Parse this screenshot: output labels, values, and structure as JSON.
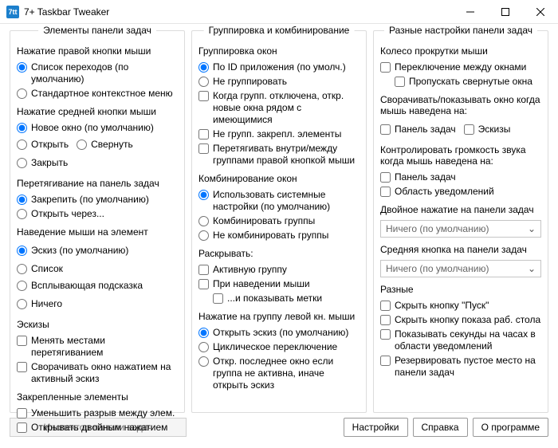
{
  "window": {
    "title": "7+ Taskbar Tweaker"
  },
  "col1": {
    "legend": "Элементы панели задач",
    "rightClick": {
      "title": "Нажатие правой кнопки мыши",
      "jumpList": "Список переходов (по умолчанию)",
      "stdMenu": "Стандартное контекстное меню"
    },
    "middleClick": {
      "title": "Нажатие средней кнопки мыши",
      "newWin": "Новое окно (по умолчанию)",
      "open": "Открыть",
      "minimize": "Свернуть",
      "close": "Закрыть"
    },
    "drag": {
      "title": "Перетягивание на панель задач",
      "pin": "Закрепить (по умолчанию)",
      "openWith": "Открыть через..."
    },
    "hover": {
      "title": "Наведение мыши на элемент",
      "thumb": "Эскиз (по умолчанию)",
      "list": "Список",
      "tooltip": "Всплывающая подсказка",
      "nothing": "Ничего"
    },
    "thumbs": {
      "title": "Эскизы",
      "dragReorder": "Менять местами перетягиванием",
      "minimizeActive": "Сворачивать окно нажатием на активный эскиз"
    },
    "pinned": {
      "title": "Закрепленные элементы",
      "reduceGap": "Уменьшить разрыв между элем.",
      "dblClickOpen": "Открывать двойным нажатием"
    }
  },
  "col2": {
    "legend": "Группировка и комбинирование",
    "grouping": {
      "title": "Группировка окон",
      "byAppId": "По ID приложения (по умолч.)",
      "dontGroup": "Не группировать",
      "whenOff": "Когда групп. отключена, откр. новые окна рядом с имеющимися",
      "dontGroupPinned": "Не групп. закрепл. элементы",
      "dragBetween": "Перетягивать внутри/между группами правой кнопкой мыши"
    },
    "combining": {
      "title": "Комбинирование окон",
      "system": "Использовать системные настройки (по умолчанию)",
      "combine": "Комбинировать группы",
      "dontCombine": "Не комбинировать группы"
    },
    "decombine": {
      "title": "Раскрывать:",
      "active": "Активную группу",
      "onHover": "При наведении мыши",
      "showLabels": "...и показывать метки"
    },
    "leftClick": {
      "title": "Нажатие на группу левой кн. мыши",
      "openThumb": "Открыть эскиз (по умолчанию)",
      "cycle": "Циклическое переключение",
      "openLast": "Откр. последнее окно если группа не активна, иначе открыть эскиз"
    }
  },
  "col3": {
    "legend": "Разные настройки панели задач",
    "wheel": {
      "title": "Колесо прокрутки мыши",
      "switchWindows": "Переключение между окнами",
      "skipMinimized": "Пропускать свернутые окна"
    },
    "minRestore": {
      "title": "Сворачивать/показывать окно когда мышь наведена на:",
      "taskbar": "Панель задач",
      "thumbs": "Эскизы"
    },
    "volume": {
      "title": "Контролировать громкость звука когда мышь наведена на:",
      "taskbar": "Панель задач",
      "tray": "Область уведомлений"
    },
    "dblClick": {
      "title": "Двойное нажатие на панели задач",
      "value": "Ничего (по умолчанию)"
    },
    "midClick": {
      "title": "Средняя кнопка на панели задач",
      "value": "Ничего (по умолчанию)"
    },
    "misc": {
      "title": "Разные",
      "hideStart": "Скрыть кнопку \"Пуск\"",
      "hideShowDesktop": "Скрыть кнопку показа раб. стола",
      "showSeconds": "Показывать секунды на часах в области уведомлений",
      "reserveEmpty": "Резервировать пустое место на панели задач"
    }
  },
  "footer": {
    "inspector": "Инспектор панели задач",
    "settings": "Настройки",
    "help": "Справка",
    "about": "О программе"
  }
}
